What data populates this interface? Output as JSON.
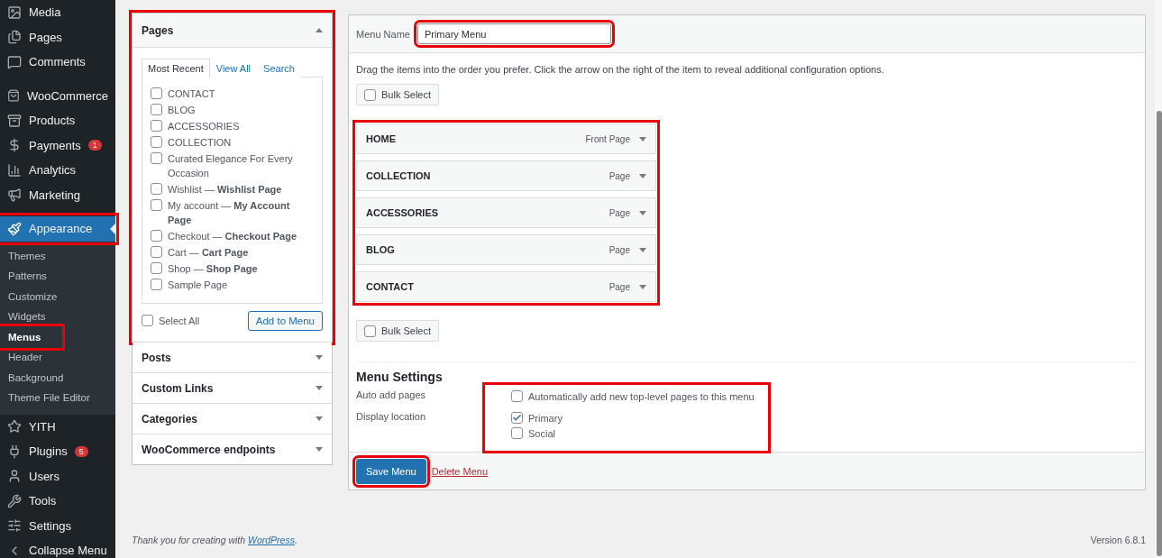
{
  "sidebar": {
    "groups": [
      [
        {
          "label": "Media",
          "selected": false,
          "highlighted": false
        },
        {
          "label": "Pages",
          "selected": false,
          "highlighted": false
        },
        {
          "label": "Comments",
          "selected": false,
          "highlighted": false
        }
      ],
      [
        {
          "label": "WooCommerce",
          "selected": false,
          "highlighted": false
        },
        {
          "label": "Products",
          "selected": false,
          "highlighted": false
        },
        {
          "label": "Payments",
          "badge": "1",
          "selected": false,
          "highlighted": false
        },
        {
          "label": "Analytics",
          "selected": false,
          "highlighted": false
        },
        {
          "label": "Marketing",
          "selected": false,
          "highlighted": false
        }
      ],
      [
        {
          "label": "Appearance",
          "selected": true,
          "highlighted": true,
          "children": [
            {
              "label": "Themes",
              "selected": false,
              "highlighted": false
            },
            {
              "label": "Patterns",
              "selected": false,
              "highlighted": false
            },
            {
              "label": "Customize",
              "selected": false,
              "highlighted": false
            },
            {
              "label": "Widgets",
              "selected": false,
              "highlighted": false
            },
            {
              "label": "Menus",
              "selected": true,
              "highlighted": true
            },
            {
              "label": "Header",
              "selected": false,
              "highlighted": false
            },
            {
              "label": "Background",
              "selected": false,
              "highlighted": false
            },
            {
              "label": "Theme File Editor",
              "selected": false,
              "highlighted": false
            }
          ]
        },
        {
          "label": "YITH",
          "selected": false,
          "highlighted": false
        },
        {
          "label": "Plugins",
          "badge": "5",
          "selected": false,
          "highlighted": false
        },
        {
          "label": "Users",
          "selected": false,
          "highlighted": false
        },
        {
          "label": "Tools",
          "selected": false,
          "highlighted": false
        },
        {
          "label": "Settings",
          "selected": false,
          "highlighted": false
        },
        {
          "label": "Collapse Menu",
          "selected": false,
          "highlighted": false
        }
      ]
    ]
  },
  "add_items": {
    "sections": [
      {
        "title": "Pages",
        "expanded": true,
        "highlighted": true,
        "tabs": [
          {
            "label": "Most Recent",
            "selected": true
          },
          {
            "label": "View All",
            "selected": false
          },
          {
            "label": "Search",
            "selected": false
          }
        ],
        "items": [
          {
            "label": "CONTACT",
            "checked": false
          },
          {
            "label": "BLOG",
            "checked": false
          },
          {
            "label": "ACCESSORIES",
            "checked": false
          },
          {
            "label": "COLLECTION",
            "checked": false
          },
          {
            "label": "Curated Elegance For Every Occasion",
            "checked": false
          },
          {
            "label": "Wishlist — **Wishlist Page**",
            "checked": false
          },
          {
            "label": "My account — **My Account Page**",
            "checked": false
          },
          {
            "label": "Checkout — **Checkout Page**",
            "checked": false
          },
          {
            "label": "Cart — **Cart Page**",
            "checked": false
          },
          {
            "label": "Shop — **Shop Page**",
            "checked": false
          },
          {
            "label": "Sample Page",
            "checked": false
          }
        ],
        "select_all": {
          "label": "Select All",
          "checked": false
        },
        "button": "Add to Menu"
      },
      {
        "title": "Posts",
        "expanded": false,
        "highlighted": false
      },
      {
        "title": "Custom Links",
        "expanded": false,
        "highlighted": false
      },
      {
        "title": "Categories",
        "expanded": false,
        "highlighted": false
      },
      {
        "title": "WooCommerce endpoints",
        "expanded": false,
        "highlighted": false
      }
    ]
  },
  "menu_editor": {
    "name_label": "Menu Name",
    "name_value": "Primary Menu",
    "name_highlighted": true,
    "instructions": "Drag the items into the order you prefer. Click the arrow on the right of the item to reveal additional configuration options.",
    "bulk_select_top": {
      "label": "Bulk Select",
      "checked": false
    },
    "items_highlighted": true,
    "items": [
      {
        "title": "HOME",
        "type": "Front Page"
      },
      {
        "title": "COLLECTION",
        "type": "Page"
      },
      {
        "title": "ACCESSORIES",
        "type": "Page"
      },
      {
        "title": "BLOG",
        "type": "Page"
      },
      {
        "title": "CONTACT",
        "type": "Page"
      }
    ],
    "bulk_select_bottom": {
      "label": "Bulk Select",
      "checked": false
    },
    "settings_title": "Menu Settings",
    "settings_highlighted": true,
    "settings": [
      {
        "label": "Auto add pages",
        "options": [
          {
            "label": "Automatically add new top-level pages to this menu",
            "checked": false
          }
        ]
      },
      {
        "label": "Display location",
        "options": [
          {
            "label": "Primary",
            "checked": true
          },
          {
            "label": "Social",
            "checked": false
          }
        ]
      }
    ],
    "save_button": "Save Menu",
    "save_highlighted": true,
    "delete_link": "Delete Menu"
  },
  "footer": {
    "credit_prefix": "Thank you for creating with ",
    "credit_link": "WordPress",
    "credit_suffix": ".",
    "version": "Version 6.8.1"
  }
}
